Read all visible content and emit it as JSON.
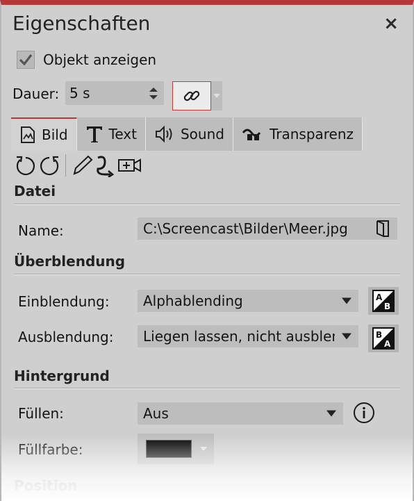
{
  "panel": {
    "title": "Eigenschaften",
    "close_icon": "×"
  },
  "show_object": {
    "label": "Objekt anzeigen",
    "checked": true
  },
  "duration": {
    "label": "Dauer:",
    "value": "5 s"
  },
  "tabs": [
    {
      "label": "Bild",
      "icon": "image-icon",
      "active": true
    },
    {
      "label": "Text",
      "icon": "text-T-icon",
      "active": false
    },
    {
      "label": "Sound",
      "icon": "speaker-icon",
      "active": false
    },
    {
      "label": "Transparenz",
      "icon": "transparency-wave-icon",
      "active": false
    }
  ],
  "toolbar_icons": [
    "rotate-left-icon",
    "rotate-right-icon",
    "pencil-icon",
    "curve-arrow-icon",
    "camera-pan-icon"
  ],
  "sections": {
    "datei": {
      "title": "Datei",
      "name_label": "Name:",
      "name_value": "C:\\Screencast\\Bilder\\Meer.jpg"
    },
    "ueberblendung": {
      "title": "Überblendung",
      "fade_in_label": "Einblendung:",
      "fade_in_value": "Alphablending",
      "fade_out_label": "Ausblendung:",
      "fade_out_value": "Liegen lassen, nicht ausblen"
    },
    "hintergrund": {
      "title": "Hintergrund",
      "fill_label": "Füllen:",
      "fill_value": "Aus",
      "fill_color_label": "Füllfarbe:",
      "fill_color": "#000000"
    },
    "position": {
      "title": "Position"
    }
  },
  "colors": {
    "accent": "#b7363a",
    "panel_bg": "#cfcfcf",
    "field_bg": "#bdbdbd"
  }
}
